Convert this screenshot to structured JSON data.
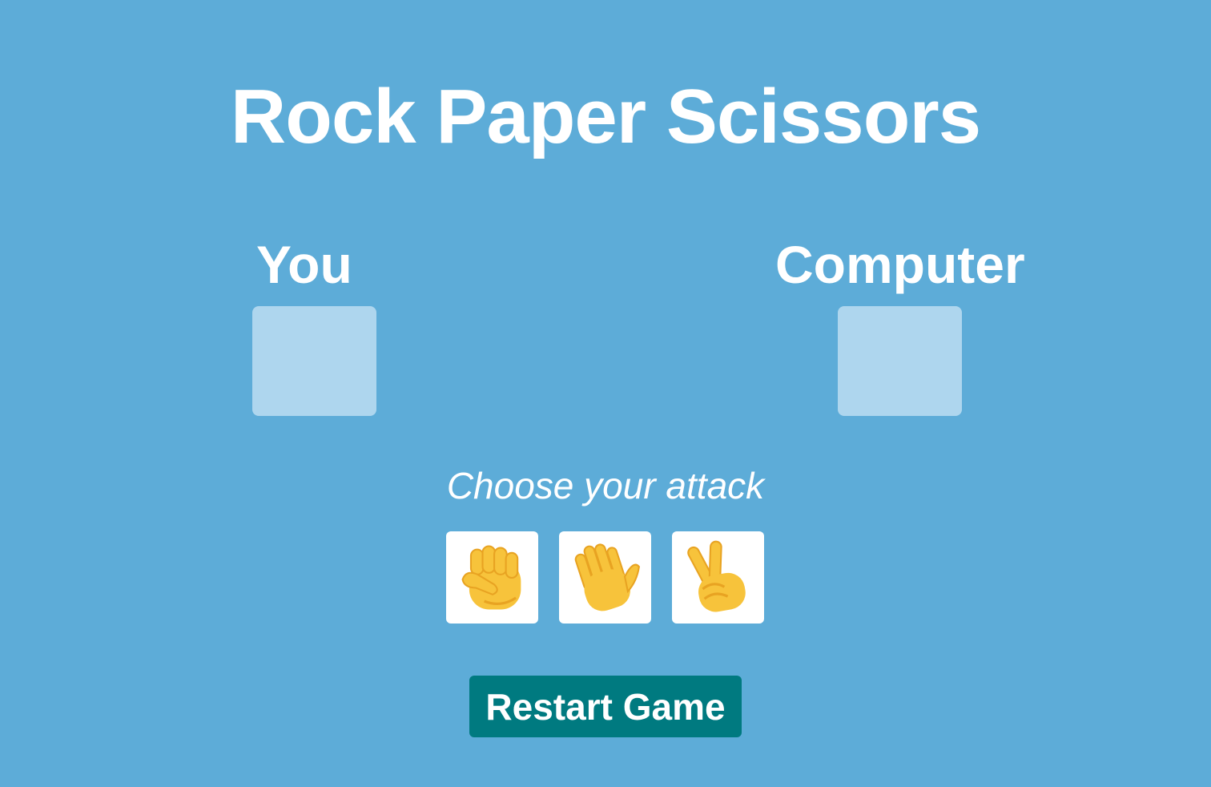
{
  "title": "Rock Paper Scissors",
  "players": {
    "you_label": "You",
    "computer_label": "Computer"
  },
  "prompt": "Choose your attack",
  "attacks": [
    {
      "name": "rock",
      "icon": "raised-fist-icon"
    },
    {
      "name": "paper",
      "icon": "waving-hand-icon"
    },
    {
      "name": "scissors",
      "icon": "victory-hand-icon"
    }
  ],
  "restart_label": "Restart Game",
  "colors": {
    "background": "#5dacd8",
    "choice_box": "#aed6ee",
    "restart_button": "#007a80",
    "emoji_skin": "#f7c33b",
    "emoji_shade": "#e8a322"
  }
}
